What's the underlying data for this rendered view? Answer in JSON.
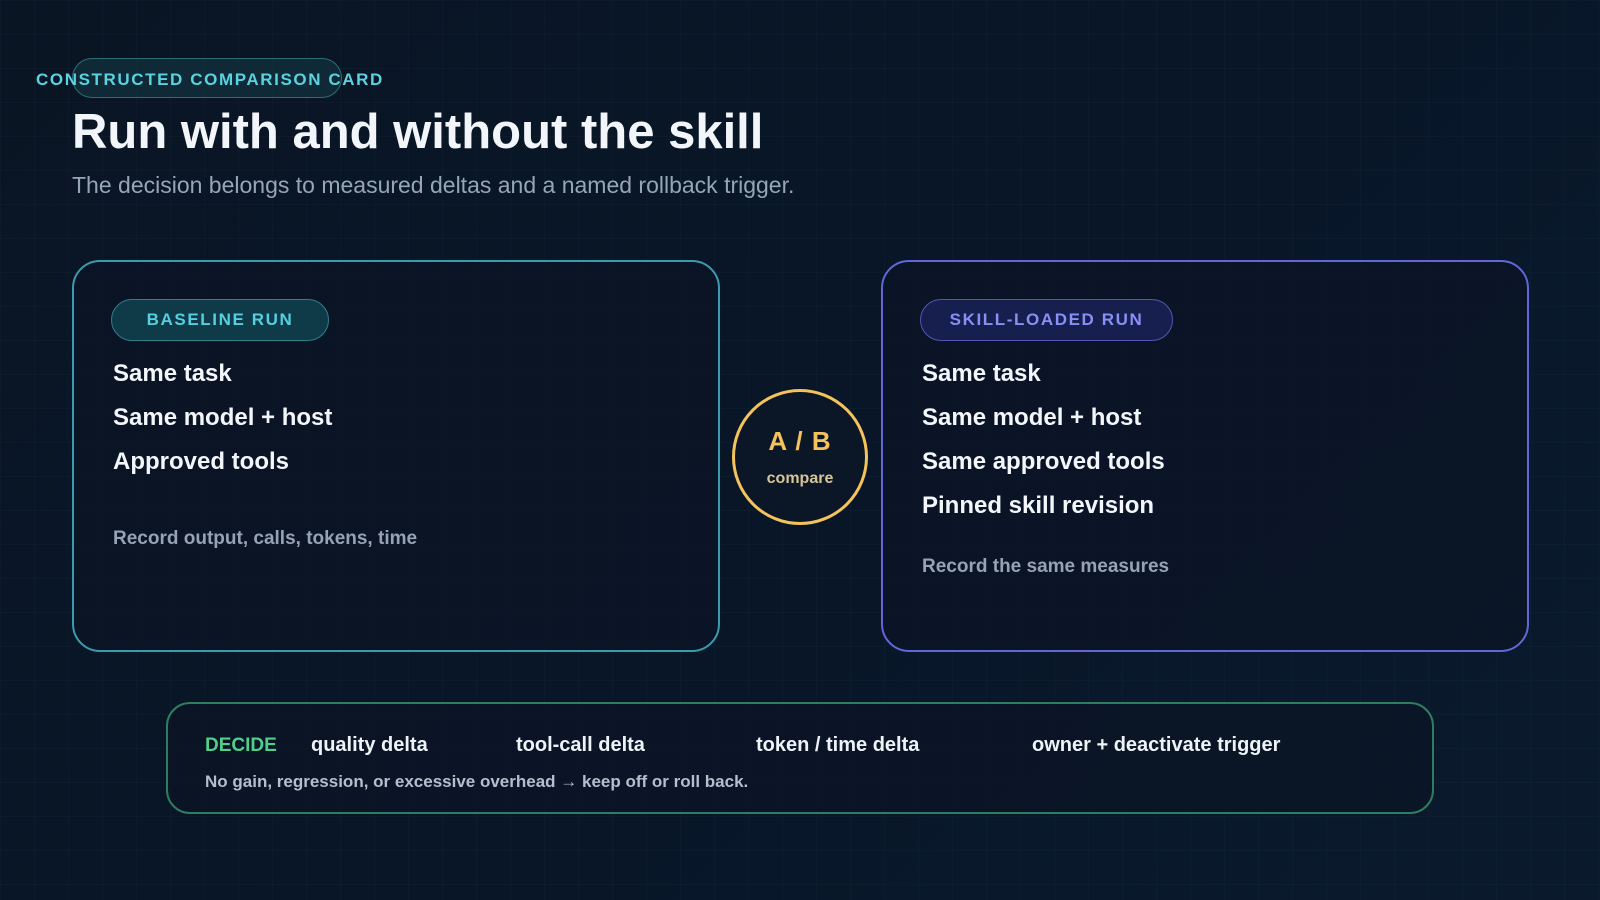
{
  "eyebrow": "CONSTRUCTED COMPARISON CARD",
  "title": "Run with and without the skill",
  "subtitle": "The decision belongs to measured deltas and a named rollback trigger.",
  "baseline": {
    "label": "BASELINE RUN",
    "items": [
      "Same task",
      "Same model + host",
      "Approved tools"
    ],
    "note": "Record output, calls, tokens, time",
    "color": "#3a9bad"
  },
  "skill": {
    "label": "SKILL-LOADED RUN",
    "items": [
      "Same task",
      "Same model + host",
      "Same approved tools",
      "Pinned skill revision"
    ],
    "note": "Record the same measures",
    "color": "#6167d8"
  },
  "compare": {
    "main": "A / B",
    "sub": "compare",
    "color": "#f5c35c"
  },
  "decide": {
    "label": "DECIDE",
    "deltas": [
      "quality delta",
      "tool-call delta",
      "token / time delta",
      "owner + deactivate trigger"
    ],
    "note": "No gain, regression, or excessive overhead → keep off or roll back.",
    "color": "#4fcf8a"
  }
}
